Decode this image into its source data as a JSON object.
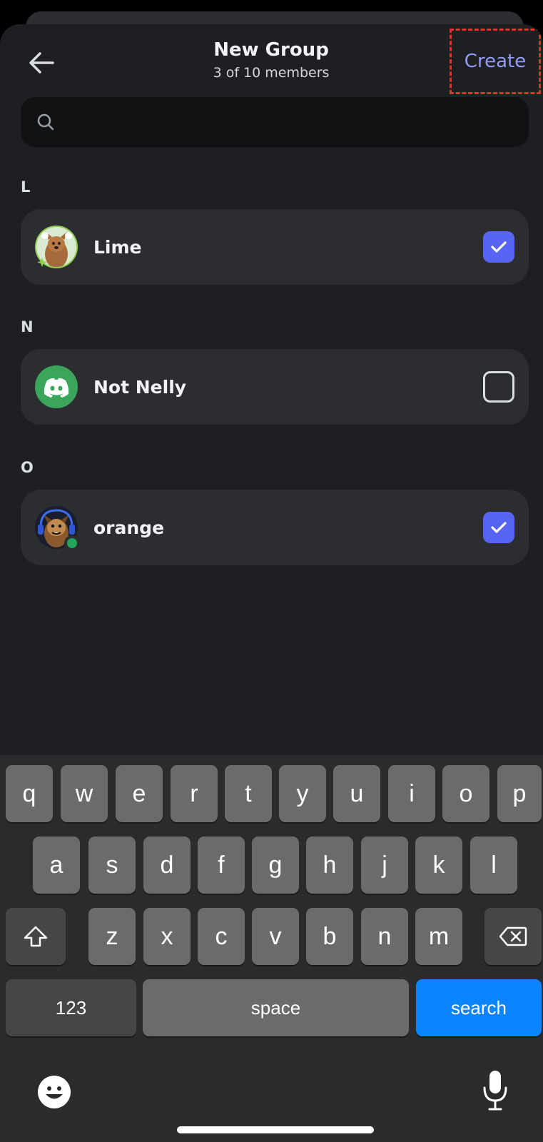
{
  "header": {
    "title": "New Group",
    "subtitle": "3 of 10 members",
    "create_label": "Create"
  },
  "search": {
    "value": "",
    "placeholder": ""
  },
  "sections": [
    {
      "letter": "L",
      "name": "Lime",
      "checked": true
    },
    {
      "letter": "N",
      "name": "Not Nelly",
      "checked": false
    },
    {
      "letter": "O",
      "name": "orange",
      "checked": true
    }
  ],
  "keyboard": {
    "row1": [
      "q",
      "w",
      "e",
      "r",
      "t",
      "y",
      "u",
      "i",
      "o",
      "p"
    ],
    "row2": [
      "a",
      "s",
      "d",
      "f",
      "g",
      "h",
      "j",
      "k",
      "l"
    ],
    "row3": [
      "z",
      "x",
      "c",
      "v",
      "b",
      "n",
      "m"
    ],
    "numbers_label": "123",
    "space_label": "space",
    "search_label": "search"
  },
  "colors": {
    "accent": "#5865f2",
    "create_text": "#949cf7",
    "online_status": "#23a55a",
    "discord_green": "#3ba55c",
    "keyboard_action": "#0a84ff",
    "highlight_border": "#e5312a"
  }
}
